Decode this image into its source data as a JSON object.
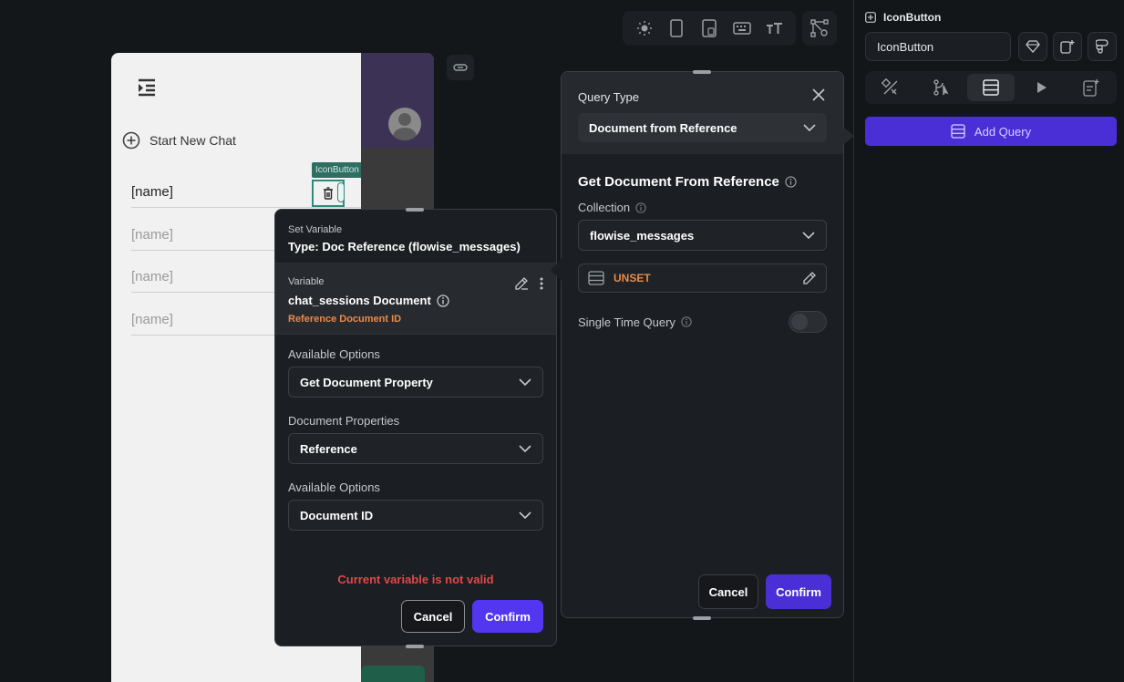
{
  "toolbar": {
    "icons": [
      "sun-icon",
      "phone-icon",
      "tablet-icon",
      "keyboard-icon",
      "text-size-icon",
      "node-settings-icon"
    ]
  },
  "canvas": {
    "start_new_chat": "Start New Chat",
    "rows": [
      "[name]",
      "[name]",
      "[name]",
      "[name]"
    ],
    "iconbutton_tag": "IconButton"
  },
  "set_variable": {
    "header_label": "Set Variable",
    "type_title": "Type: Doc Reference (flowise_messages)",
    "variable_label": "Variable",
    "variable_name": "chat_sessions Document",
    "reference_label": "Reference Document ID",
    "available_options_label": "Available Options",
    "available_options_value": "Get Document Property",
    "document_properties_label": "Document Properties",
    "document_properties_value": "Reference",
    "available_options_2_label": "Available Options",
    "available_options_2_value": "Document ID",
    "error": "Current variable is not valid",
    "cancel": "Cancel",
    "confirm": "Confirm"
  },
  "query_panel": {
    "title": "Query Type",
    "query_type_value": "Document from Reference",
    "section_title": "Get Document From Reference",
    "collection_label": "Collection",
    "collection_value": "flowise_messages",
    "unset_label": "UNSET",
    "single_time_query_label": "Single Time Query",
    "cancel": "Cancel",
    "confirm": "Confirm"
  },
  "sidebar": {
    "title": "IconButton",
    "name_value": "IconButton",
    "add_query": "Add Query"
  },
  "colors": {
    "accent": "#5336f0",
    "error": "#e04848",
    "warning": "#e88a4a"
  }
}
